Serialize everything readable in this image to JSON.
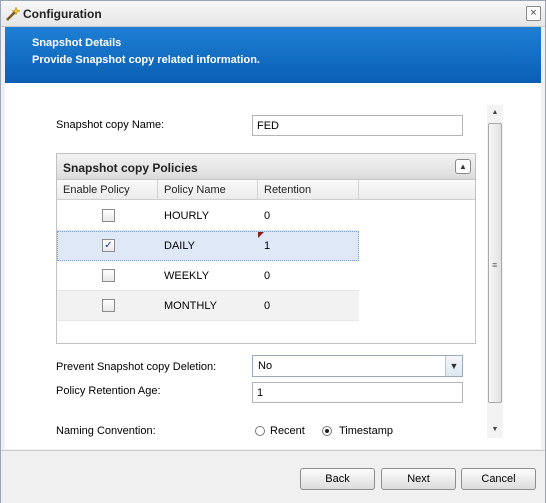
{
  "window": {
    "title": "Configuration",
    "close_glyph": "×"
  },
  "banner": {
    "title": "Snapshot Details",
    "subtitle": "Provide Snapshot copy related information."
  },
  "form": {
    "snapshot_name_label": "Snapshot copy Name:",
    "snapshot_name_value": "FED",
    "prevent_deletion_label": "Prevent Snapshot copy Deletion:",
    "prevent_deletion_value": "No",
    "retention_age_label": "Policy Retention Age:",
    "retention_age_value": "1",
    "naming_label": "Naming Convention:",
    "naming_options": [
      "Recent",
      "Timestamp"
    ],
    "naming_selected": "Timestamp"
  },
  "policies": {
    "title": "Snapshot copy Policies",
    "columns": [
      "Enable Policy",
      "Policy Name",
      "Retention"
    ],
    "rows": [
      {
        "enabled": false,
        "name": "HOURLY",
        "retention": "0"
      },
      {
        "enabled": true,
        "name": "DAILY",
        "retention": "1"
      },
      {
        "enabled": false,
        "name": "WEEKLY",
        "retention": "0"
      },
      {
        "enabled": false,
        "name": "MONTHLY",
        "retention": "0"
      }
    ]
  },
  "buttons": {
    "back": "Back",
    "next": "Next",
    "cancel": "Cancel"
  },
  "icons": {
    "title": "wand-icon",
    "close": "close-icon",
    "collapse": "collapse-icon",
    "dropdown": "chevron-down-icon"
  },
  "colors": {
    "banner": "#0a5fb4",
    "selection": "#dfe8f6"
  }
}
